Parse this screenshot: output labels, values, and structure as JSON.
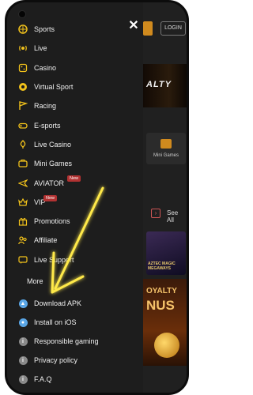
{
  "header": {
    "login_label": "LOGIN"
  },
  "drawer": {
    "close_glyph": "✕",
    "items": [
      {
        "label": "Sports",
        "icon": "sports-icon"
      },
      {
        "label": "Live",
        "icon": "live-icon"
      },
      {
        "label": "Casino",
        "icon": "casino-icon"
      },
      {
        "label": "Virtual Sport",
        "icon": "virtual-sport-icon"
      },
      {
        "label": "Racing",
        "icon": "racing-icon"
      },
      {
        "label": "E-sports",
        "icon": "esports-icon"
      },
      {
        "label": "Live Casino",
        "icon": "live-casino-icon"
      },
      {
        "label": "Mini Games",
        "icon": "mini-games-icon"
      },
      {
        "label": "AVIATOR",
        "icon": "aviator-icon",
        "badge": "New"
      },
      {
        "label": "VIP",
        "icon": "vip-icon",
        "badge": "New"
      },
      {
        "label": "Promotions",
        "icon": "promotions-icon"
      },
      {
        "label": "Affiliate",
        "icon": "affiliate-icon"
      },
      {
        "label": "Live Support",
        "icon": "live-support-icon"
      }
    ],
    "more_label": "More",
    "extra_items": [
      {
        "label": "Download APK",
        "icon": "android-icon"
      },
      {
        "label": "Install on iOS",
        "icon": "apple-icon"
      },
      {
        "label": "Responsible gaming",
        "icon": "info-icon"
      },
      {
        "label": "Privacy policy",
        "icon": "info-icon"
      },
      {
        "label": "F.A.Q",
        "icon": "info-icon"
      }
    ]
  },
  "background": {
    "banner_text": "ALTY",
    "tile_label": "Mini Games",
    "see_all_label": "See All",
    "game_text": "AZTEC MAGIC MEGAWAYS",
    "loyalty_line1": "OYALTY",
    "loyalty_line2": "NUS"
  },
  "colors": {
    "accent_yellow": "#f2c21b",
    "badge_red": "#b23232",
    "drawer_bg": "#1d1d1d",
    "android_blue": "#5aa6e6",
    "info_grey": "#8a8a8a"
  }
}
